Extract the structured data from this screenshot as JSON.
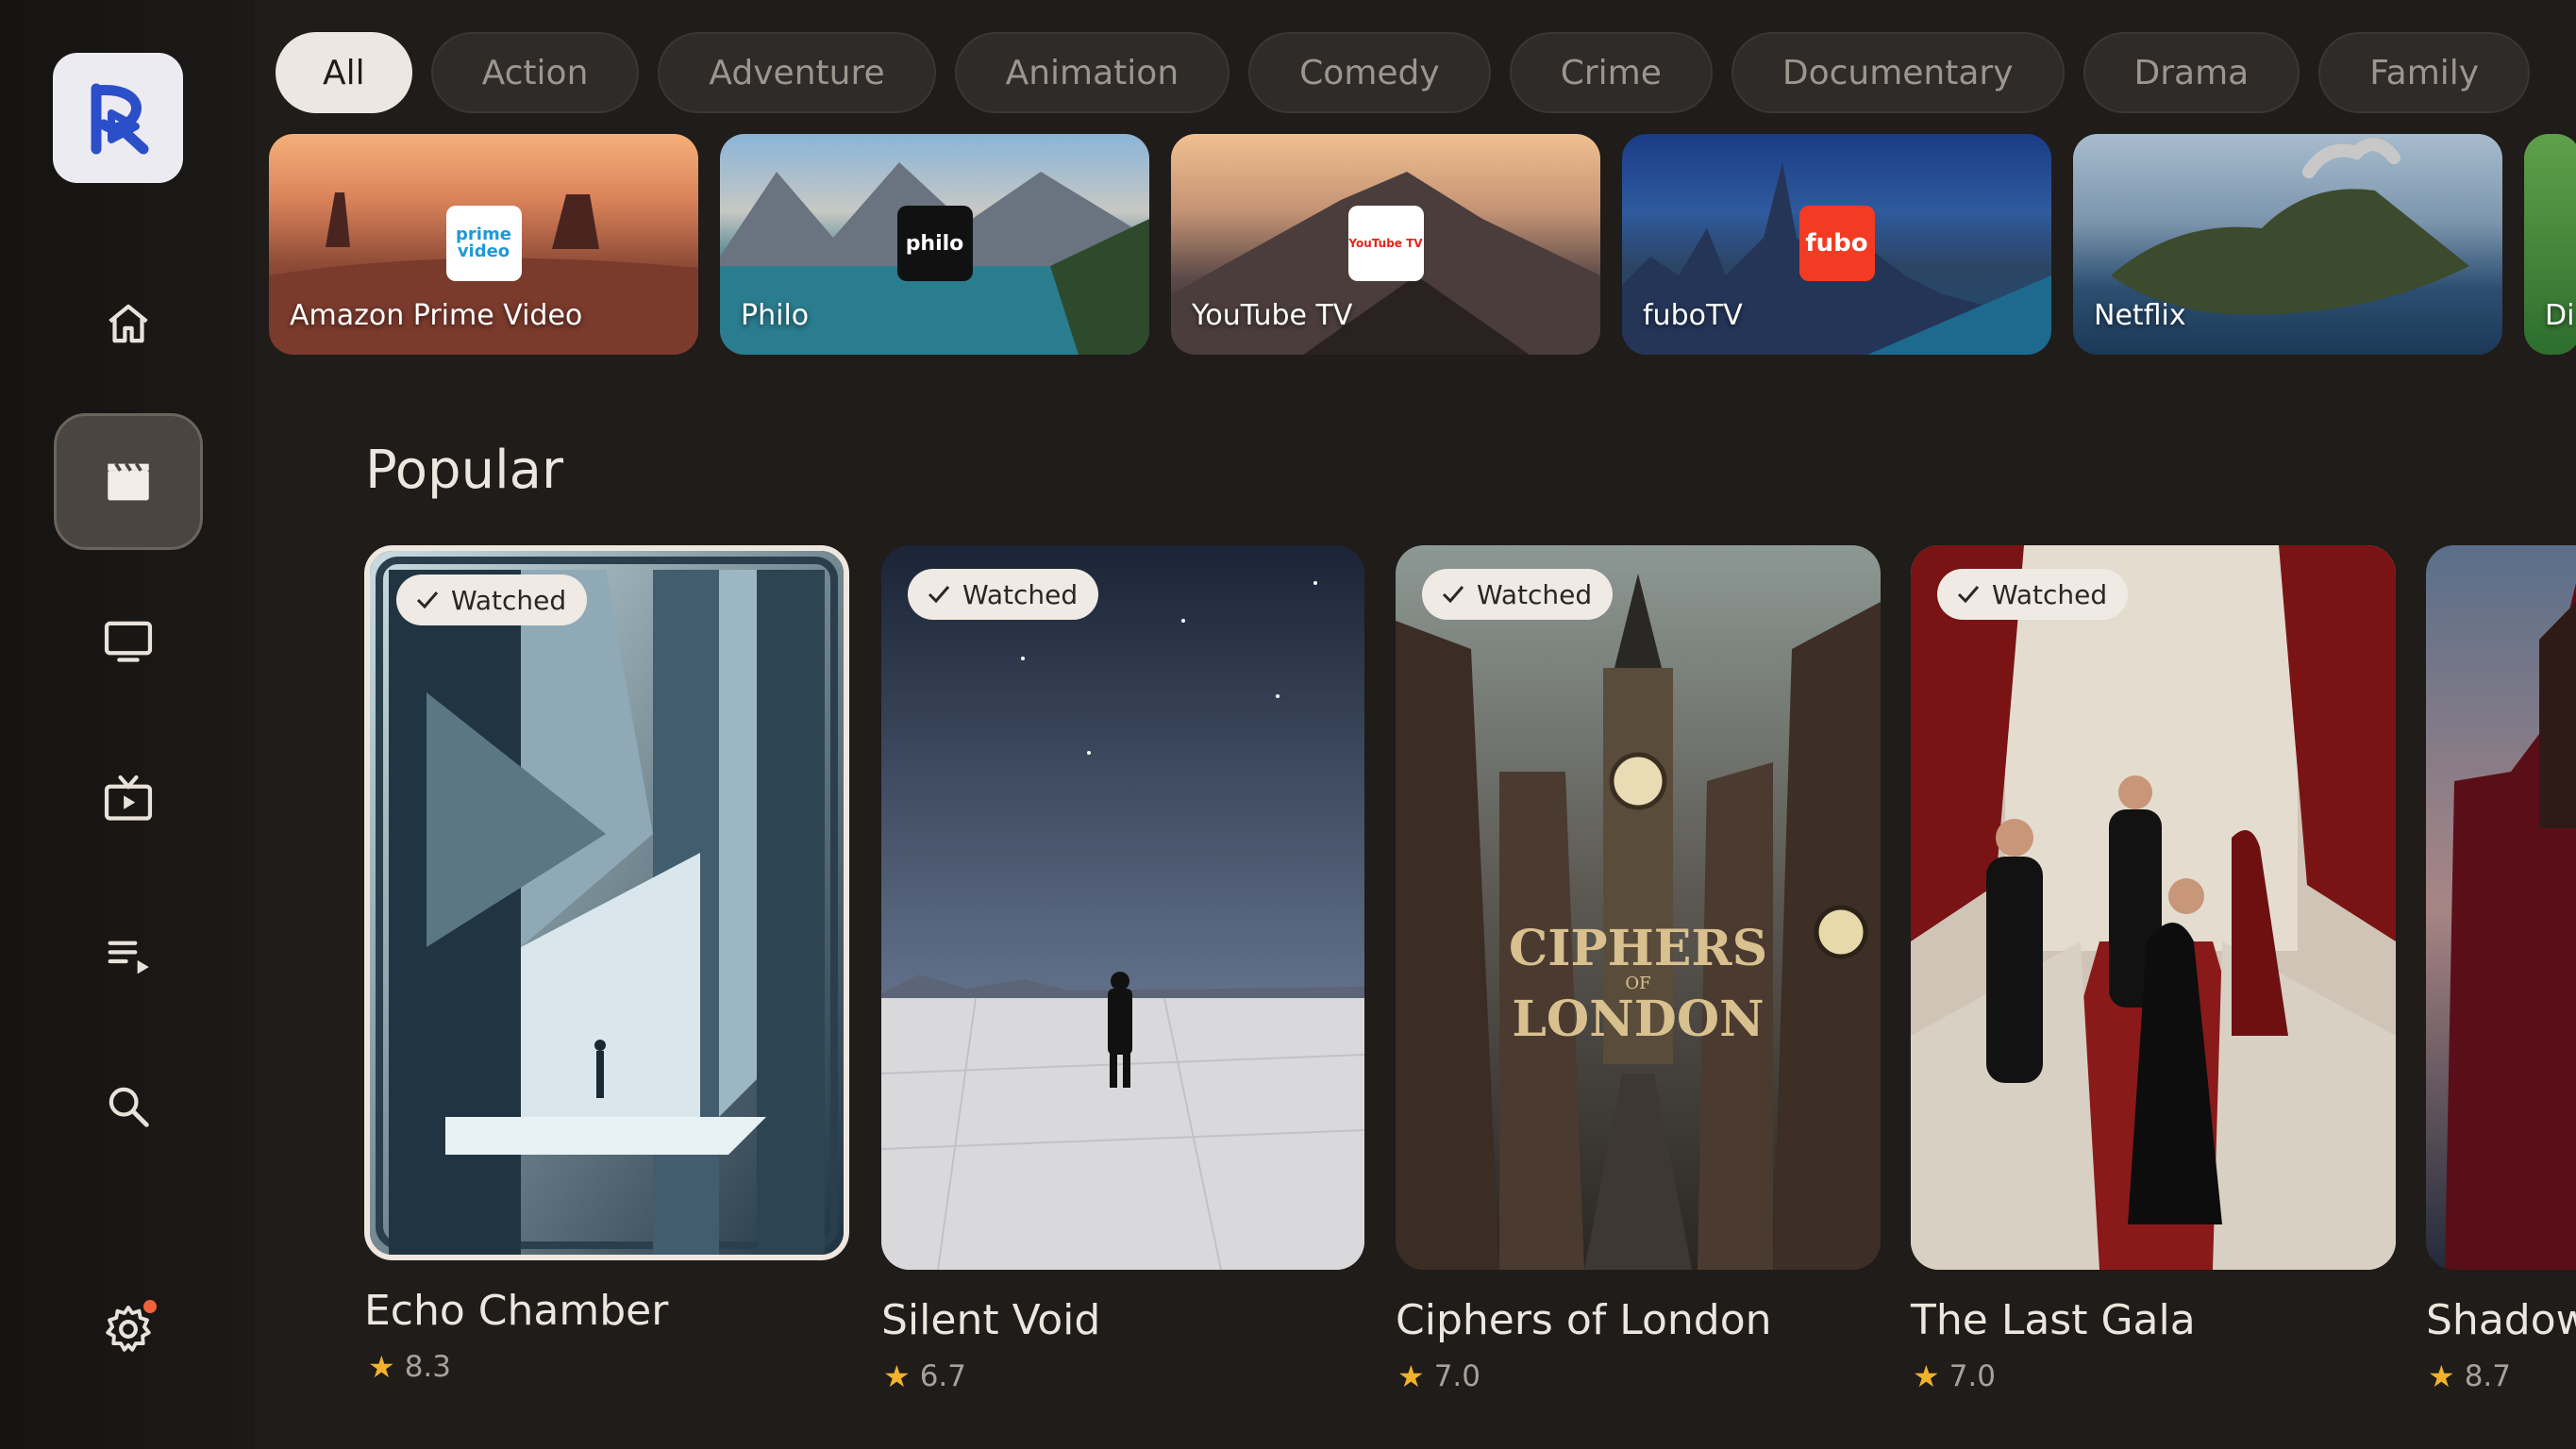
{
  "filters": {
    "chips": [
      "All",
      "Action",
      "Adventure",
      "Animation",
      "Comedy",
      "Crime",
      "Documentary",
      "Drama",
      "Family"
    ],
    "selected": "All"
  },
  "services": [
    {
      "label": "Amazon Prime Video",
      "badge": "prime video",
      "badge_bg": "#ffffff",
      "badge_fg": "#1f99d6"
    },
    {
      "label": "Philo",
      "badge": "philo",
      "badge_bg": "#111111",
      "badge_fg": "#ffffff"
    },
    {
      "label": "YouTube TV",
      "badge": "YouTube TV",
      "badge_bg": "#ffffff",
      "badge_fg": "#e5231b"
    },
    {
      "label": "fuboTV",
      "badge": "fubo",
      "badge_bg": "#f23b22",
      "badge_fg": "#ffffff"
    },
    {
      "label": "Netflix",
      "badge": "",
      "badge_bg": "",
      "badge_fg": ""
    },
    {
      "label": "Di",
      "badge": "",
      "badge_bg": "",
      "badge_fg": ""
    }
  ],
  "popular": {
    "title": "Popular",
    "badge_label": "Watched",
    "items": [
      {
        "title": "Echo Chamber",
        "rating": "8.3",
        "watched": true
      },
      {
        "title": "Silent Void",
        "rating": "6.7",
        "watched": true
      },
      {
        "title": "Ciphers of London",
        "rating": "7.0",
        "watched": true
      },
      {
        "title": "The Last Gala",
        "rating": "7.0",
        "watched": true
      },
      {
        "title": "Shadow",
        "rating": "8.7",
        "watched": false
      }
    ]
  },
  "poster_texts": {
    "ciphers_line1": "CIPHERS",
    "ciphers_of": "OF",
    "ciphers_line2": "LONDON"
  },
  "colors": {
    "accent_dot": "#f0623a",
    "star": "#f2b22c",
    "logo_blue": "#2b4fc9"
  }
}
